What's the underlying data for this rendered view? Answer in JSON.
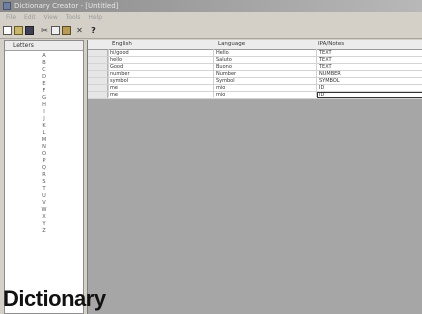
{
  "window": {
    "title": "Dictionary Creator - [Untitled]"
  },
  "menu": [
    "File",
    "Edit",
    "View",
    "Tools",
    "Help"
  ],
  "toolbar": [
    {
      "name": "new-file-icon",
      "glyph": ""
    },
    {
      "name": "open-folder-icon",
      "glyph": ""
    },
    {
      "name": "save-icon",
      "glyph": ""
    },
    {
      "name": "cut-icon",
      "glyph": "✂"
    },
    {
      "name": "copy-icon",
      "glyph": ""
    },
    {
      "name": "paste-icon",
      "glyph": ""
    },
    {
      "name": "delete-icon",
      "glyph": "✕"
    },
    {
      "name": "find-icon",
      "glyph": "?"
    }
  ],
  "letters_panel": {
    "header": "Letters",
    "letters": [
      "A",
      "B",
      "C",
      "D",
      "E",
      "F",
      "G",
      "H",
      "I",
      "J",
      "K",
      "L",
      "M",
      "N",
      "O",
      "P",
      "Q",
      "R",
      "S",
      "T",
      "U",
      "V",
      "W",
      "X",
      "Y",
      "Z"
    ]
  },
  "grid": {
    "columns": [
      "English",
      "Language",
      "IPA/Notes"
    ],
    "rows": [
      [
        "hi/good",
        "Hello",
        "TEXT"
      ],
      [
        "hello",
        "Saluto",
        "TEXT"
      ],
      [
        "Good",
        "Buono",
        "TEXT"
      ],
      [
        "number",
        "Number",
        "NUMBER"
      ],
      [
        "symbol",
        "Symbol",
        "SYMBOL"
      ],
      [
        "me",
        "mio",
        "ID"
      ],
      [
        "me",
        "mio",
        "ID"
      ]
    ]
  },
  "caption": "Dictionary"
}
